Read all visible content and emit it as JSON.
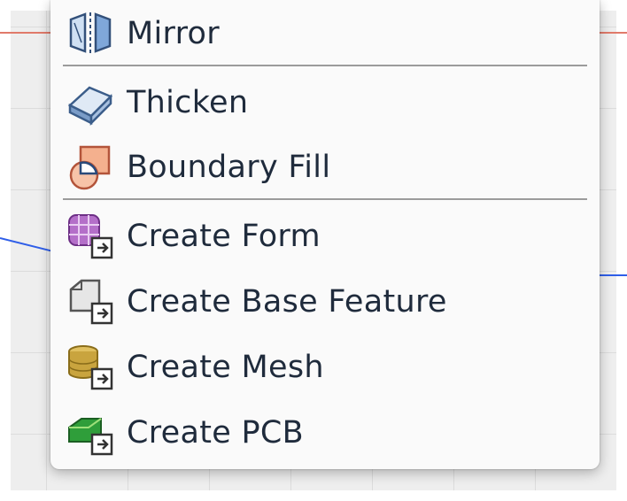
{
  "menu": {
    "items": [
      {
        "label": "Mirror",
        "icon": "mirror-icon"
      },
      {
        "label": "Thicken",
        "icon": "thicken-icon"
      },
      {
        "label": "Boundary Fill",
        "icon": "boundary-fill-icon"
      },
      {
        "label": "Create Form",
        "icon": "create-form-icon"
      },
      {
        "label": "Create Base Feature",
        "icon": "create-base-feature-icon"
      },
      {
        "label": "Create Mesh",
        "icon": "create-mesh-icon"
      },
      {
        "label": "Create PCB",
        "icon": "create-pcb-icon"
      }
    ]
  },
  "colors": {
    "text": "#1f2b3c",
    "menu_background": "#fafafa",
    "separator": "#9b9b9b",
    "canvas_background": "#eeeeee",
    "red_axis": "#e07a6a",
    "blue_axis": "#2f5ee8"
  }
}
